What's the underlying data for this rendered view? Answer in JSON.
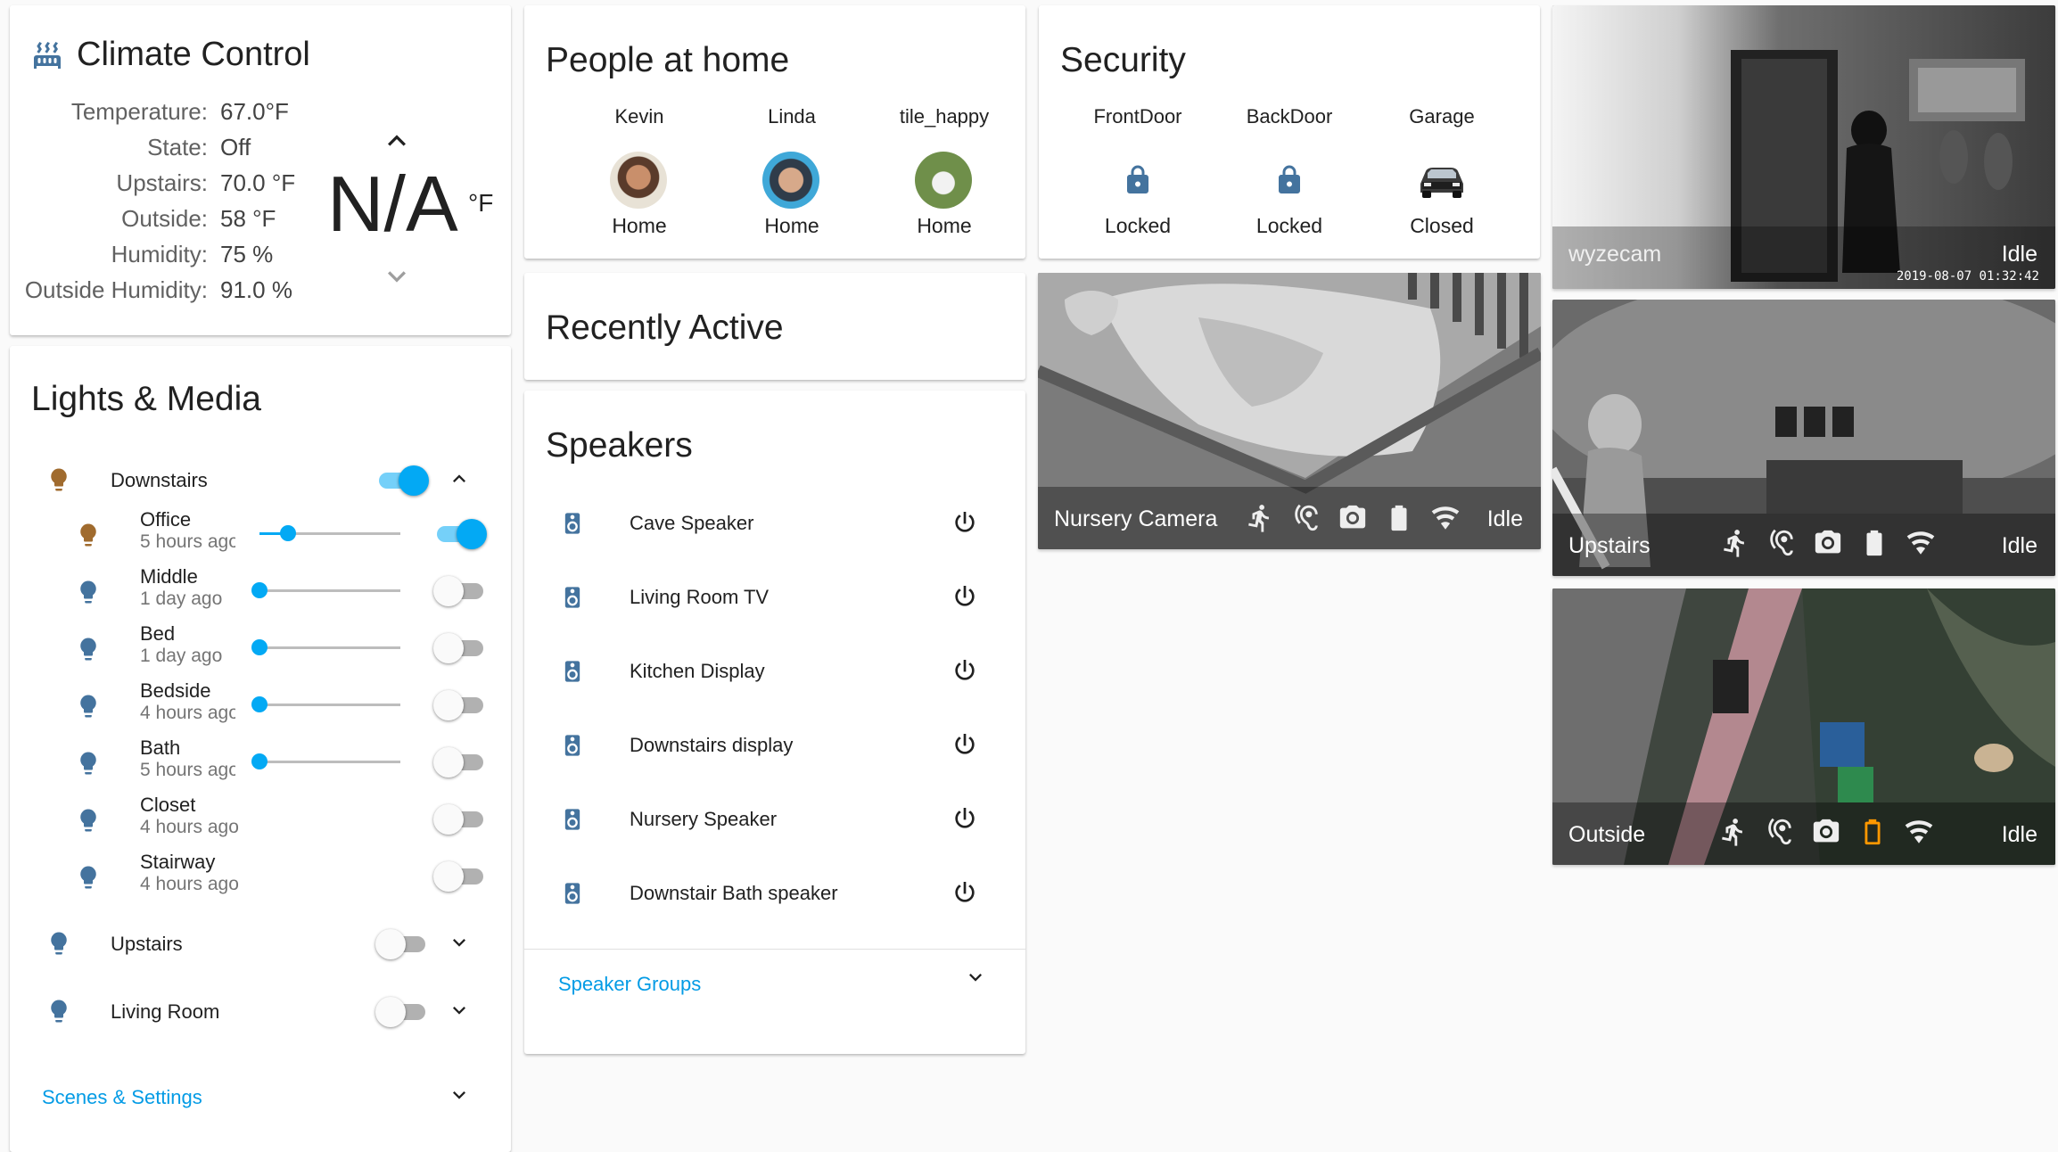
{
  "colors": {
    "accent": "#03a9f4",
    "link": "#039be5",
    "lock": "#44739e",
    "bulb_on": "#a06b2e",
    "bulb_off": "#44739e",
    "battery_low": "#ff9800"
  },
  "climate": {
    "title": "Climate Control",
    "icon": "radiator-icon",
    "rows": [
      {
        "label": "Temperature:",
        "value": "67.0°F"
      },
      {
        "label": "State:",
        "value": "Off"
      },
      {
        "label": "Upstairs:",
        "value": "70.0 °F"
      },
      {
        "label": "Outside:",
        "value": "58 °F"
      },
      {
        "label": "Humidity:",
        "value": "75 %"
      },
      {
        "label": "Outside Humidity:",
        "value": "91.0 %"
      }
    ],
    "target": "N/A",
    "target_unit": "°F"
  },
  "people": {
    "title": "People at home",
    "persons": [
      {
        "name": "Kevin",
        "state": "Home"
      },
      {
        "name": "Linda",
        "state": "Home"
      },
      {
        "name": "tile_happy",
        "state": "Home"
      }
    ]
  },
  "security": {
    "title": "Security",
    "items": [
      {
        "name": "FrontDoor",
        "state": "Locked",
        "icon": "lock-icon"
      },
      {
        "name": "BackDoor",
        "state": "Locked",
        "icon": "lock-icon"
      },
      {
        "name": "Garage",
        "state": "Closed",
        "icon": "car-icon"
      }
    ]
  },
  "recent": {
    "title": "Recently Active"
  },
  "lights": {
    "title": "Lights & Media",
    "groups": [
      {
        "name": "Downstairs",
        "on": true,
        "expanded": true
      },
      {
        "name": "Upstairs",
        "on": false,
        "expanded": false
      },
      {
        "name": "Living Room",
        "on": false,
        "expanded": false
      }
    ],
    "items": [
      {
        "name": "Office",
        "sub": "5 hours ago",
        "brightness": 0.2,
        "on": true
      },
      {
        "name": "Middle",
        "sub": "1 day ago",
        "brightness": 0,
        "on": false
      },
      {
        "name": "Bed",
        "sub": "1 day ago",
        "brightness": 0,
        "on": false
      },
      {
        "name": "Bedside",
        "sub": "4 hours ago",
        "brightness": 0,
        "on": false
      },
      {
        "name": "Bath",
        "sub": "5 hours ago",
        "brightness": 0,
        "on": false
      },
      {
        "name": "Closet",
        "sub": "4 hours ago",
        "on": false
      },
      {
        "name": "Stairway",
        "sub": "4 hours ago",
        "on": false
      }
    ],
    "footer_link": "Scenes & Settings"
  },
  "speakers": {
    "title": "Speakers",
    "items": [
      {
        "name": "Cave Speaker"
      },
      {
        "name": "Living Room TV"
      },
      {
        "name": "Kitchen Display"
      },
      {
        "name": "Downstairs display"
      },
      {
        "name": "Nursery Speaker"
      },
      {
        "name": "Downstair Bath speaker"
      }
    ],
    "footer_link": "Speaker Groups"
  },
  "cameras": [
    {
      "name": "Nursery Camera",
      "state": "Idle"
    },
    {
      "name": "wyzecam",
      "state": "Idle",
      "timestamp": "2019-08-07 01:32:42"
    },
    {
      "name": "Upstairs",
      "state": "Idle"
    },
    {
      "name": "Outside",
      "state": "Idle"
    }
  ]
}
